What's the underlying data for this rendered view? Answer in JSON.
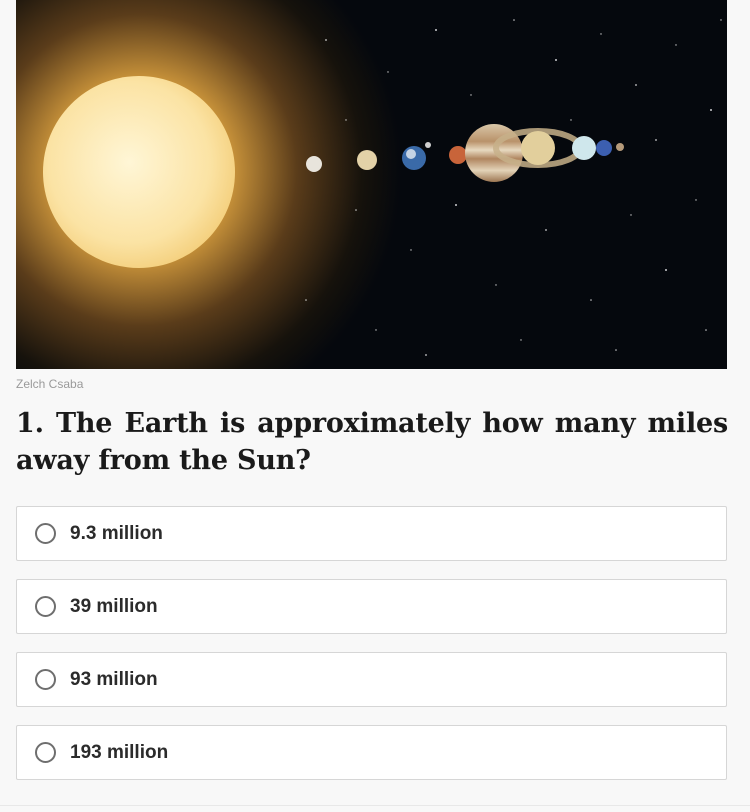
{
  "image": {
    "alt": "",
    "credit": "Zelch Csaba"
  },
  "question": {
    "text": "1. The Earth is approximately how many miles away from the Sun?"
  },
  "options": [
    {
      "label": "9.3 million"
    },
    {
      "label": "39 million"
    },
    {
      "label": "93 million"
    },
    {
      "label": "193 million"
    }
  ]
}
